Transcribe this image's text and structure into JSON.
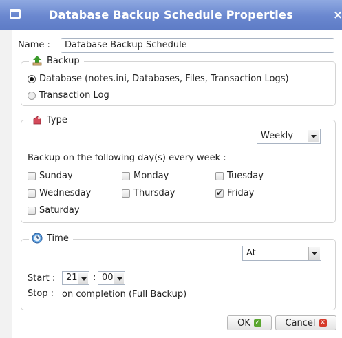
{
  "window": {
    "title": "Database Backup Schedule Properties",
    "close_glyph": "×"
  },
  "name": {
    "label": "Name :",
    "value": "Database Backup Schedule"
  },
  "backup": {
    "legend": "Backup",
    "options": [
      {
        "label": "Database (notes.ini, Databases, Files, Transaction Logs)",
        "selected": true
      },
      {
        "label": "Transaction Log",
        "selected": false
      }
    ]
  },
  "type": {
    "legend": "Type",
    "frequency": "Weekly",
    "days_prompt": "Backup on the following day(s) every week :",
    "days": {
      "sunday": {
        "label": "Sunday",
        "checked": false
      },
      "monday": {
        "label": "Monday",
        "checked": false
      },
      "tuesday": {
        "label": "Tuesday",
        "checked": false
      },
      "wednesday": {
        "label": "Wednesday",
        "checked": false
      },
      "thursday": {
        "label": "Thursday",
        "checked": false
      },
      "friday": {
        "label": "Friday",
        "checked": true
      },
      "saturday": {
        "label": "Saturday",
        "checked": false
      }
    }
  },
  "time": {
    "legend": "Time",
    "mode": "At",
    "start_label": "Start :",
    "start_hour": "21",
    "separator": ":",
    "start_minute": "00",
    "stop_label": "Stop :",
    "stop_value": "on completion (Full Backup)"
  },
  "buttons": {
    "ok": "OK",
    "cancel": "Cancel"
  },
  "icons": [
    "window-menu-icon",
    "close-icon",
    "backup-icon",
    "type-icon",
    "clock-icon",
    "ok-check-icon",
    "cancel-x-icon"
  ],
  "colors": {
    "titlebar": "#6a87cf",
    "ok_green": "#5aa62f",
    "cancel_red": "#d63a2a"
  }
}
